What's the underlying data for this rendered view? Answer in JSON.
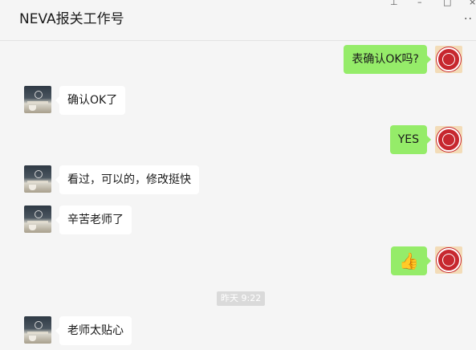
{
  "window": {
    "title": "NEVA报关工作号",
    "controls": {
      "pin": "⊥",
      "minimize": "–",
      "maximize": "□",
      "close": "×"
    },
    "more_label": "··"
  },
  "messages": [
    {
      "side": "right",
      "text": "表确认OK吗?"
    },
    {
      "side": "left",
      "text": "确认OK了"
    },
    {
      "side": "right",
      "text": "YES"
    },
    {
      "side": "left",
      "text": "看过，可以的，修改挺快"
    },
    {
      "side": "left",
      "text": "辛苦老师了"
    },
    {
      "side": "right",
      "text": "👍",
      "kind": "emoji",
      "icon": "thumbs-up-icon"
    },
    {
      "side": "left",
      "text": "老师太贴心"
    }
  ],
  "timestamp": "昨天 9:22",
  "colors": {
    "background": "#f5f5f5",
    "outgoing_bubble": "#95ec69",
    "incoming_bubble": "#ffffff",
    "timestamp_bg": "#dadada"
  }
}
